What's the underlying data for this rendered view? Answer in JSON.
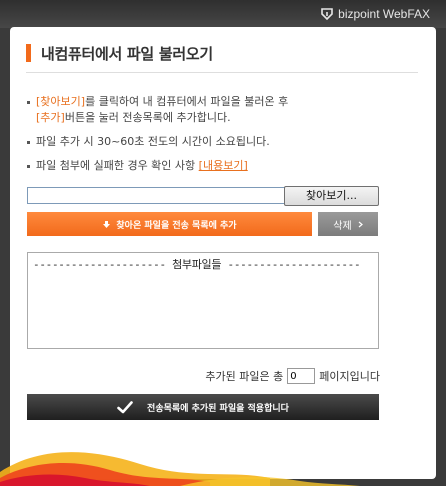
{
  "brand": {
    "name": "bizpoint WebFAX"
  },
  "title": "내컴퓨터에서 파일 불러오기",
  "instructions": {
    "line1_pre": "",
    "line1_browse": "[찾아보기]",
    "line1_post": "를 클릭하여 내 컴퓨터에서 파일을 불러온 후",
    "line2_add": "[추가]",
    "line2_post": "버튼을 눌러 전송목록에 추가합니다.",
    "line3": "파일 추가 시 30~60초 전도의 시간이 소요됩니다.",
    "line4_pre": "파일 첨부에 실패한 경우 확인 사항 ",
    "line4_link": "[내용보기]"
  },
  "file_input": {
    "value": ""
  },
  "buttons": {
    "browse": "찾아보기...",
    "add": "찾아온 파일을 전송 목록에 추가",
    "delete": "삭제",
    "apply": "전송목록에 추가된 파일을 적용합니다"
  },
  "attachments": {
    "header": "--------------------- 첨부파일들 ---------------------"
  },
  "page_count": {
    "label_pre": "추가된 파일은 총",
    "value": "0",
    "label_post": "페이지입니다"
  },
  "colors": {
    "accent": "#f26a1b",
    "dark": "#2b2b2b",
    "gray_button": "#8a8a8a"
  }
}
